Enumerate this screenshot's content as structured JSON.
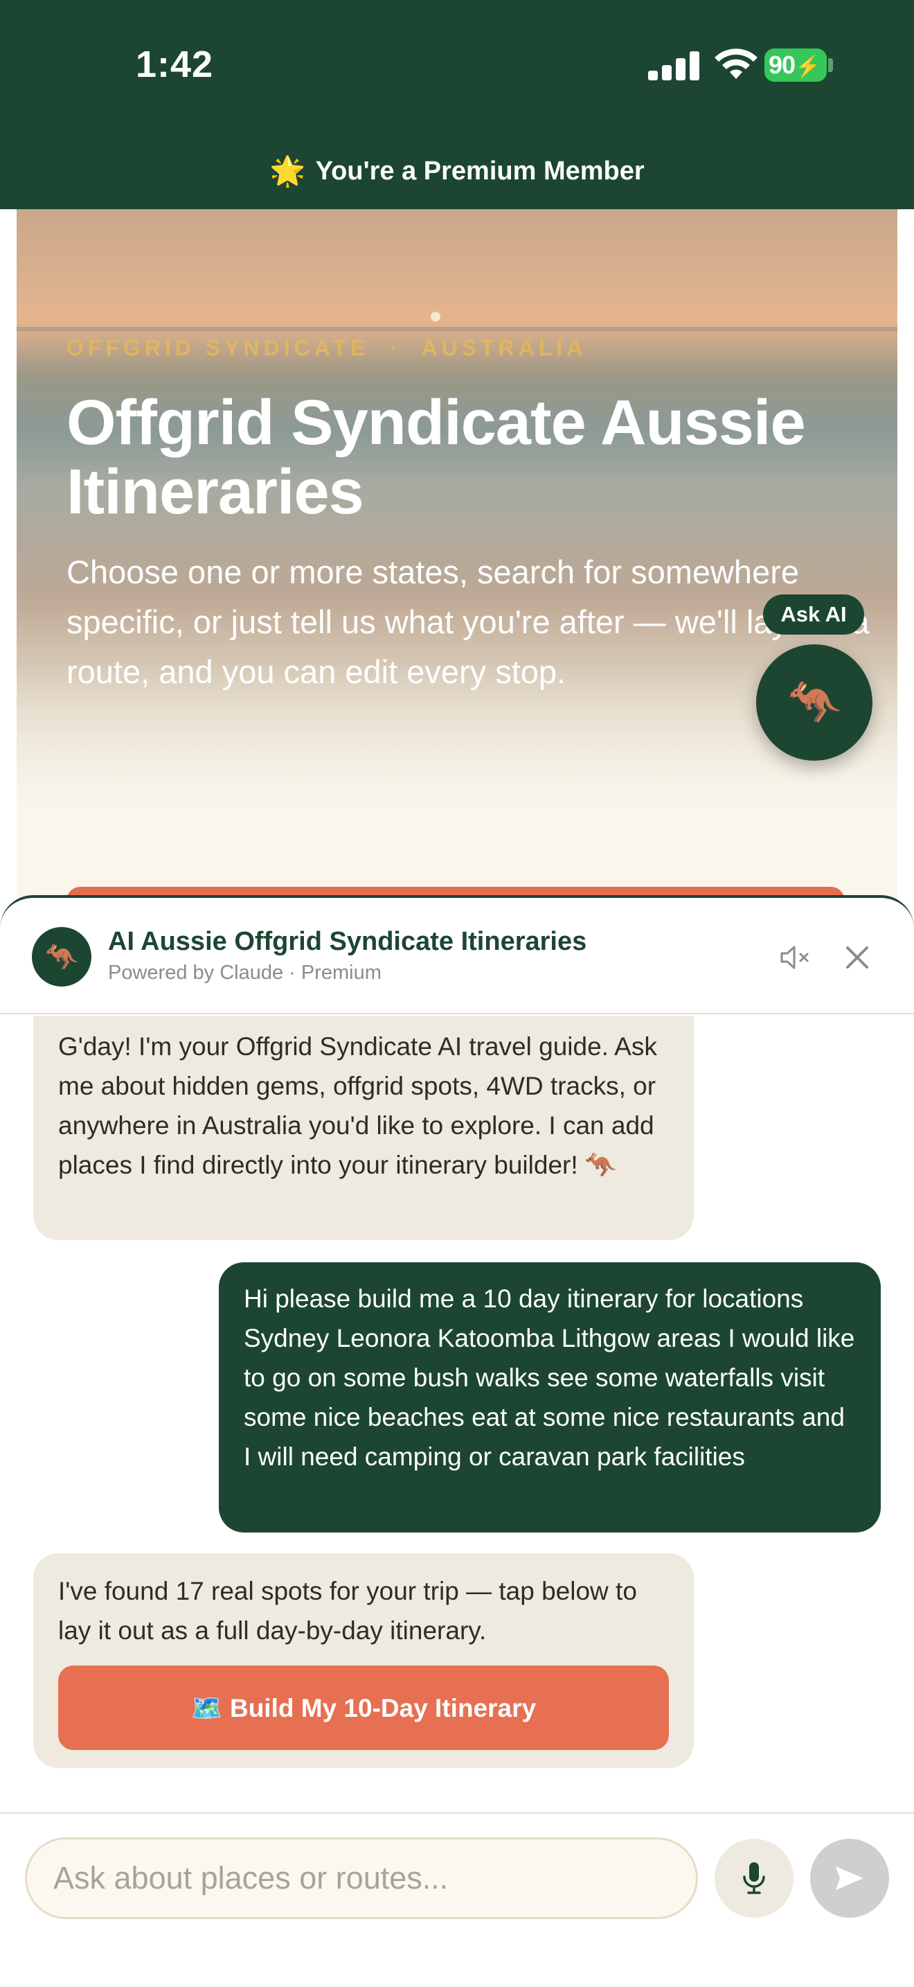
{
  "status_bar": {
    "time": "1:42",
    "battery": "90",
    "icons": [
      "cellular-signal-icon",
      "wifi-icon",
      "battery-charging-icon"
    ]
  },
  "premium_banner": {
    "icon": "star-icon",
    "text": "You're a Premium Member"
  },
  "hero": {
    "kicker": "OFFGRID SYNDICATE  ·  AUSTRALIA",
    "title": "Offgrid Syndicate Aussie Itineraries",
    "description": "Choose one or more states, search for somewhere specific, or just tell us what you're after — we'll lay out a route, and you can edit every stop."
  },
  "ask_ai": {
    "label": "Ask AI",
    "icon": "kangaroo-icon"
  },
  "chat": {
    "header": {
      "avatar_icon": "kangaroo-icon",
      "title": "AI Aussie Offgrid Syndicate Itineraries",
      "subtitle": "Powered by Claude · Premium",
      "mute_icon": "speaker-muted-icon",
      "close_icon": "close-icon"
    },
    "messages": [
      {
        "role": "assistant",
        "text": "G'day! I'm your Offgrid Syndicate AI travel guide. Ask me about hidden gems, offgrid spots, 4WD tracks, or anywhere in Australia you'd like to explore. I can add places I find directly into your itinerary builder! 🦘"
      },
      {
        "role": "user",
        "text": "Hi please build me a 10 day itinerary for locations Sydney Leonora Katoomba Lithgow areas I would like to go on some bush walks see some waterfalls visit some nice beaches eat at some nice restaurants and I will need camping or caravan park facilities"
      },
      {
        "role": "assistant",
        "text": "I've found 17 real spots for your trip — tap below to lay it out as a full day-by-day itinerary.",
        "action_label": "Build My 10-Day Itinerary",
        "action_icon": "map-icon"
      }
    ],
    "composer": {
      "placeholder": "Ask about places or routes...",
      "value": "",
      "mic_icon": "microphone-icon",
      "send_icon": "send-icon"
    }
  },
  "colors": {
    "brand_green": "#1c4632",
    "accent_orange": "#e67051",
    "kicker_gold": "#e0b560",
    "ai_bubble": "#eeeae0"
  }
}
